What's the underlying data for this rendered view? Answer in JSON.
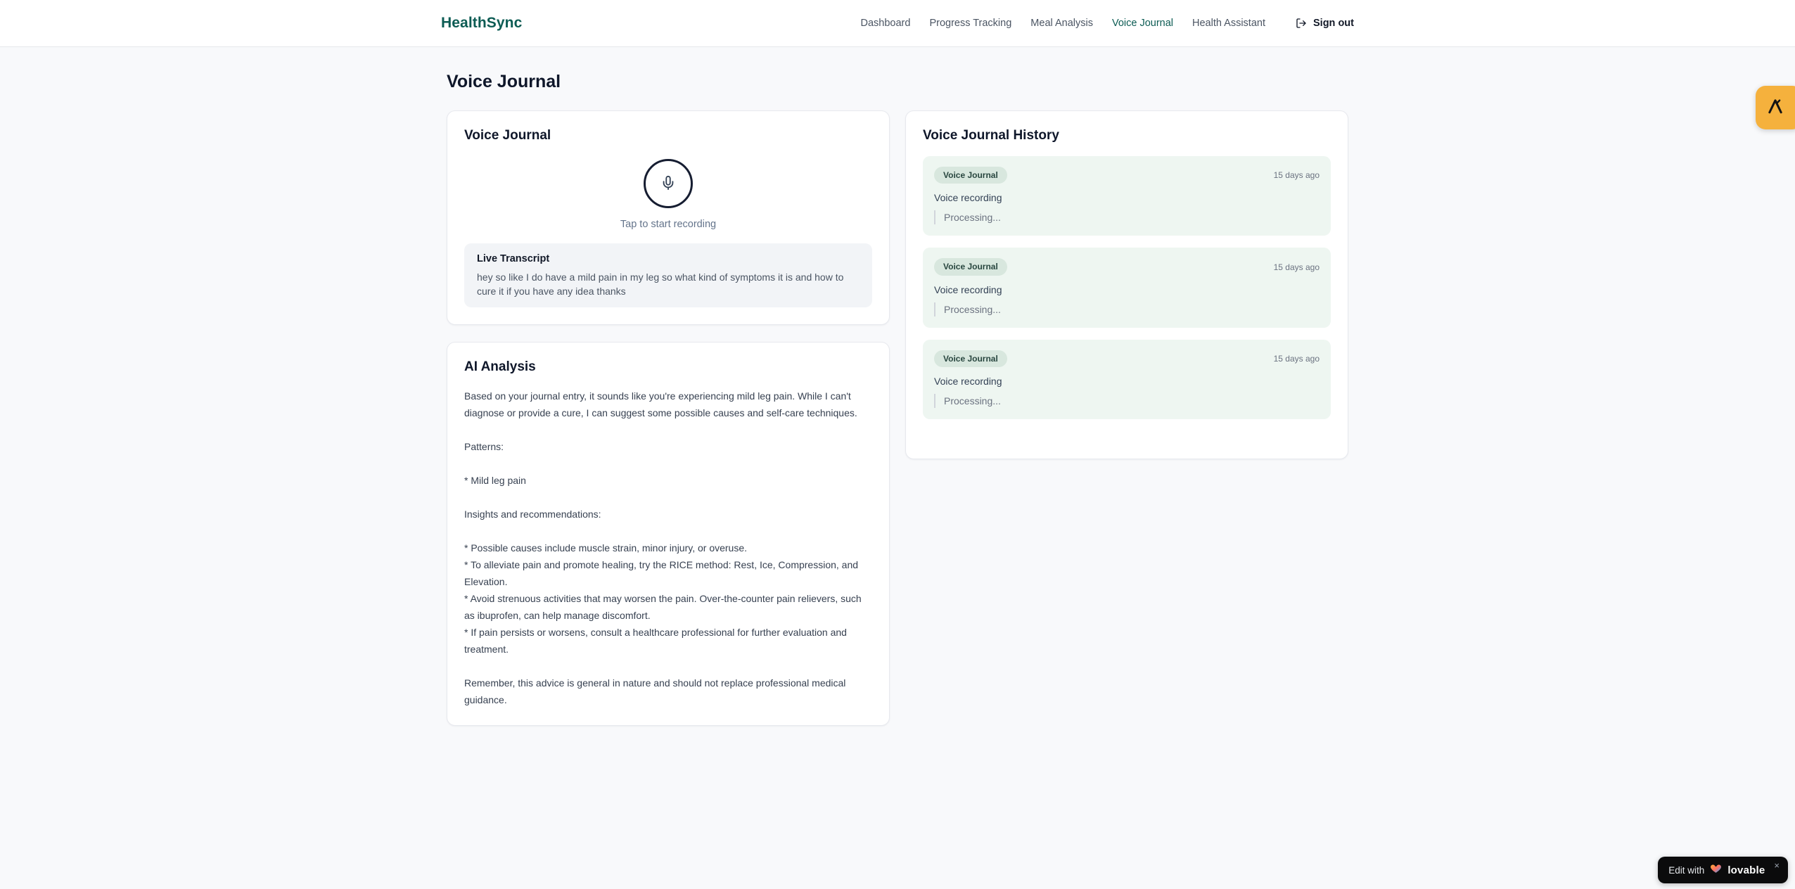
{
  "header": {
    "brand": "HealthSync",
    "nav": [
      {
        "label": "Dashboard",
        "active": false
      },
      {
        "label": "Progress Tracking",
        "active": false
      },
      {
        "label": "Meal Analysis",
        "active": false
      },
      {
        "label": "Voice Journal",
        "active": true
      },
      {
        "label": "Health Assistant",
        "active": false
      }
    ],
    "sign_out": "Sign out"
  },
  "page_title": "Voice Journal",
  "recorder": {
    "title": "Voice Journal",
    "hint": "Tap to start recording",
    "transcript_title": "Live Transcript",
    "transcript": "hey so like I do have a mild pain in my leg so what kind of symptoms it is and how to cure it if you have any idea thanks"
  },
  "analysis": {
    "title": "AI Analysis",
    "text": "Based on your journal entry, it sounds like you're experiencing mild leg pain. While I can't diagnose or provide a cure, I can suggest some possible causes and self-care techniques.\n\nPatterns:\n\n* Mild leg pain\n\nInsights and recommendations:\n\n* Possible causes include muscle strain, minor injury, or overuse.\n* To alleviate pain and promote healing, try the RICE method: Rest, Ice, Compression, and Elevation.\n* Avoid strenuous activities that may worsen the pain. Over-the-counter pain relievers, such as ibuprofen, can help manage discomfort.\n* If pain persists or worsens, consult a healthcare professional for further evaluation and treatment.\n\nRemember, this advice is general in nature and should not replace professional medical guidance."
  },
  "history": {
    "title": "Voice Journal History",
    "entries": [
      {
        "badge": "Voice Journal",
        "time": "15 days ago",
        "label": "Voice recording",
        "status": "Processing..."
      },
      {
        "badge": "Voice Journal",
        "time": "15 days ago",
        "label": "Voice recording",
        "status": "Processing..."
      },
      {
        "badge": "Voice Journal",
        "time": "15 days ago",
        "label": "Voice recording",
        "status": "Processing..."
      }
    ]
  },
  "lovable": {
    "prefix": "Edit with",
    "brand": "lovable",
    "close": "×"
  },
  "colors": {
    "brand_teal": "#0d5c54",
    "accent_amber": "#f5b13d",
    "history_entry_bg": "#eef6f1",
    "badge_bg": "#d8e7de",
    "badge_text": "#28463f",
    "page_bg": "#f8f9fb"
  }
}
